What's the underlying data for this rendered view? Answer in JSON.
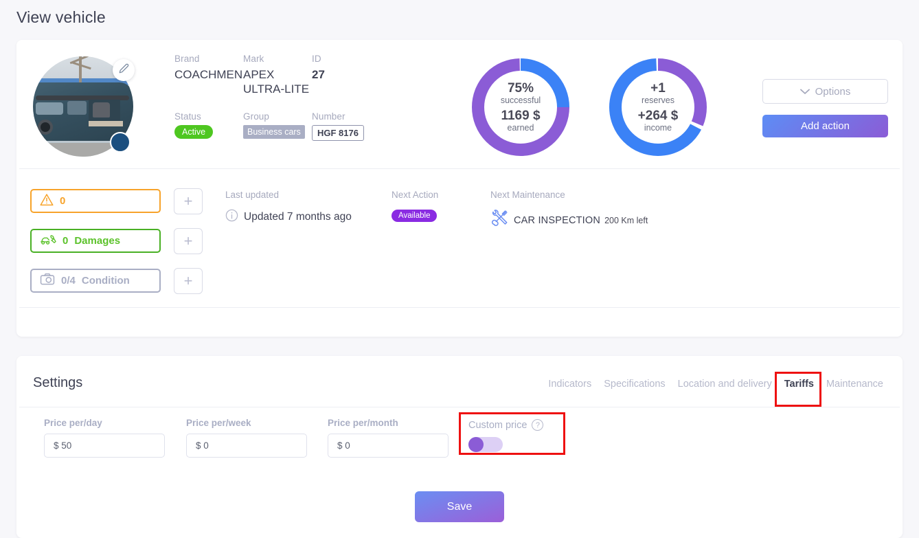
{
  "page": {
    "title": "View vehicle"
  },
  "vehicle": {
    "avatar_alt": "vehicle-photo",
    "edit_icon": "pencil-icon",
    "specs": {
      "brand_label": "Brand",
      "brand_value": "COACHMEN",
      "mark_label": "Mark",
      "mark_value": "APEX ULTRA-LITE",
      "id_label": "ID",
      "id_value": "27",
      "status_label": "Status",
      "status_value": "Active",
      "group_label": "Group",
      "group_value": "Business cars",
      "number_label": "Number",
      "number_value": "HGF 8176"
    }
  },
  "donuts": [
    {
      "name": "successful",
      "percent_text": "75%",
      "percent_caption": "successful",
      "amount_text": "1169 $",
      "amount_caption": "earned",
      "purple_share": 75,
      "blue_share": 25
    },
    {
      "name": "income",
      "percent_text": "+1",
      "percent_caption": "reserves",
      "amount_text": "+264 $",
      "amount_caption": "income",
      "purple_share": 32,
      "blue_share": 68
    }
  ],
  "actions": {
    "options_label": "Options",
    "options_icon": "chevron-down-icon",
    "add_action_label": "Add action"
  },
  "indicators": [
    {
      "icon": "warning-triangle-icon",
      "count": "0",
      "label": "",
      "color": "#f7a32a",
      "add_label": "+"
    },
    {
      "icon": "car-repair-icon",
      "count": "0",
      "label": "Damages",
      "color": "#49b024",
      "add_label": "+"
    },
    {
      "icon": "camera-icon",
      "count": "0/4",
      "label": "Condition",
      "color": "#a9aec4",
      "add_label": "+"
    }
  ],
  "info": {
    "last_updated_label": "Last updated",
    "last_updated_value": "Updated 7 months ago",
    "last_updated_icon": "info-icon",
    "next_action_label": "Next Action",
    "next_action_value": "Available",
    "next_maintenance_label": "Next Maintenance",
    "next_maintenance_icon": "tools-icon",
    "next_maintenance_value": "CAR INSPECTION",
    "next_maintenance_distance": "200 Km left"
  },
  "settings": {
    "title": "Settings",
    "tabs": [
      {
        "label": "Indicators",
        "active": false
      },
      {
        "label": "Specifications",
        "active": false
      },
      {
        "label": "Location and delivery",
        "active": false
      },
      {
        "label": "Tariffs",
        "active": true
      },
      {
        "label": "Maintenance",
        "active": false
      }
    ],
    "fields": [
      {
        "label": "Price per/day",
        "value": "$ 50",
        "placeholder": "$ 0"
      },
      {
        "label": "Price per/week",
        "value": "$ 0",
        "placeholder": "$ 0"
      },
      {
        "label": "Price per/month",
        "value": "$ 0",
        "placeholder": "$ 0"
      }
    ],
    "custom_price": {
      "label": "Custom price",
      "help_icon": "question-mark-icon",
      "help_text": "?",
      "enabled": false
    },
    "save_label": "Save"
  },
  "annotations": {
    "highlight_color": "#ee1111",
    "items": [
      "tariffs-tab",
      "custom-price-toggle"
    ]
  },
  "colors": {
    "blue": "#3b82f6",
    "purple": "#8b5cd6",
    "green": "#4ec720",
    "orange": "#f7a32a",
    "gray": "#a9aec4",
    "text": "#3f4254"
  }
}
